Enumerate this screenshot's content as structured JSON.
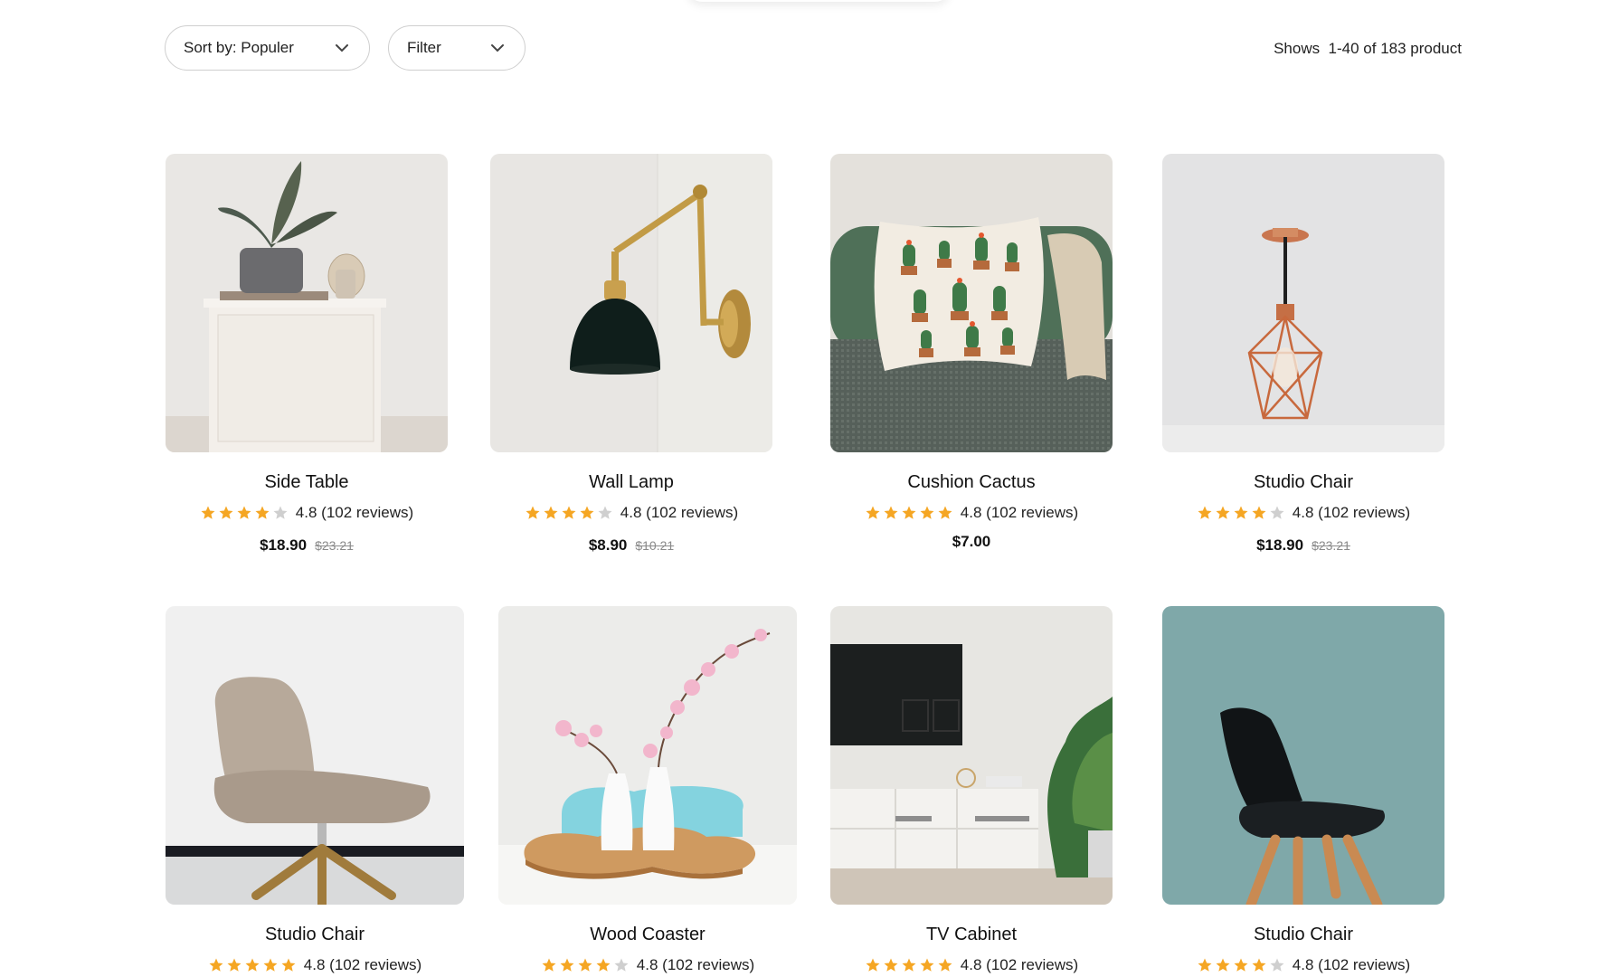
{
  "toolbar": {
    "sort_label": "Sort by: Populer",
    "filter_label": "Filter",
    "results_text": "Shows  1-40 of 183 product"
  },
  "colors": {
    "star_filled": "#f5a623",
    "star_empty": "#cfcfcf"
  },
  "products": [
    {
      "name": "Side Table",
      "stars": 4,
      "rating_text": "4.8 (102 reviews)",
      "price": "$18.90",
      "old_price": "$23.21"
    },
    {
      "name": "Wall Lamp",
      "stars": 4,
      "rating_text": "4.8 (102 reviews)",
      "price": "$8.90",
      "old_price": "$10.21"
    },
    {
      "name": "Cushion Cactus",
      "stars": 5,
      "rating_text": "4.8 (102 reviews)",
      "price": "$7.00",
      "old_price": ""
    },
    {
      "name": "Studio Chair",
      "stars": 4,
      "rating_text": "4.8 (102 reviews)",
      "price": "$18.90",
      "old_price": "$23.21"
    },
    {
      "name": "Studio Chair",
      "stars": 5,
      "rating_text": "4.8 (102 reviews)",
      "price": "",
      "old_price": ""
    },
    {
      "name": "Wood Coaster",
      "stars": 4,
      "rating_text": "4.8 (102 reviews)",
      "price": "",
      "old_price": ""
    },
    {
      "name": "TV Cabinet",
      "stars": 5,
      "rating_text": "4.8 (102 reviews)",
      "price": "",
      "old_price": ""
    },
    {
      "name": "Studio Chair",
      "stars": 4,
      "rating_text": "4.8 (102 reviews)",
      "price": "",
      "old_price": ""
    }
  ]
}
